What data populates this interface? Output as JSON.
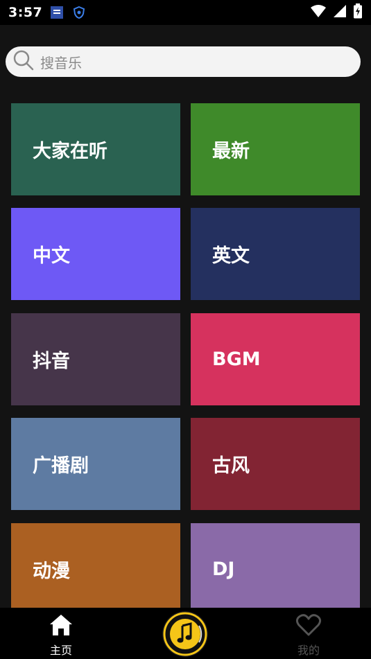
{
  "status_bar": {
    "time": "3:57",
    "icons": [
      "sim-notification-icon",
      "shield-notification-icon",
      "wifi-icon",
      "signal-icon",
      "battery-charging-icon"
    ]
  },
  "search": {
    "placeholder": "搜音乐",
    "icon": "search-icon"
  },
  "categories": [
    {
      "label": "大家在听",
      "color": "#2a6251"
    },
    {
      "label": "最新",
      "color": "#3f8a2a"
    },
    {
      "label": "中文",
      "color": "#6e59f5"
    },
    {
      "label": "英文",
      "color": "#24305f"
    },
    {
      "label": "抖音",
      "color": "#46354a"
    },
    {
      "label": "BGM",
      "color": "#d6325e"
    },
    {
      "label": "广播剧",
      "color": "#5e7ba2"
    },
    {
      "label": "古风",
      "color": "#822433"
    },
    {
      "label": "动漫",
      "color": "#ab6022"
    },
    {
      "label": "DJ",
      "color": "#8a6aa8"
    }
  ],
  "bottom_nav": {
    "home_label": "主页",
    "mine_label": "我的",
    "home_icon": "home-icon",
    "mine_icon": "heart-icon",
    "player_icon": "music-note-icon",
    "accent_color": "#f5c518"
  }
}
